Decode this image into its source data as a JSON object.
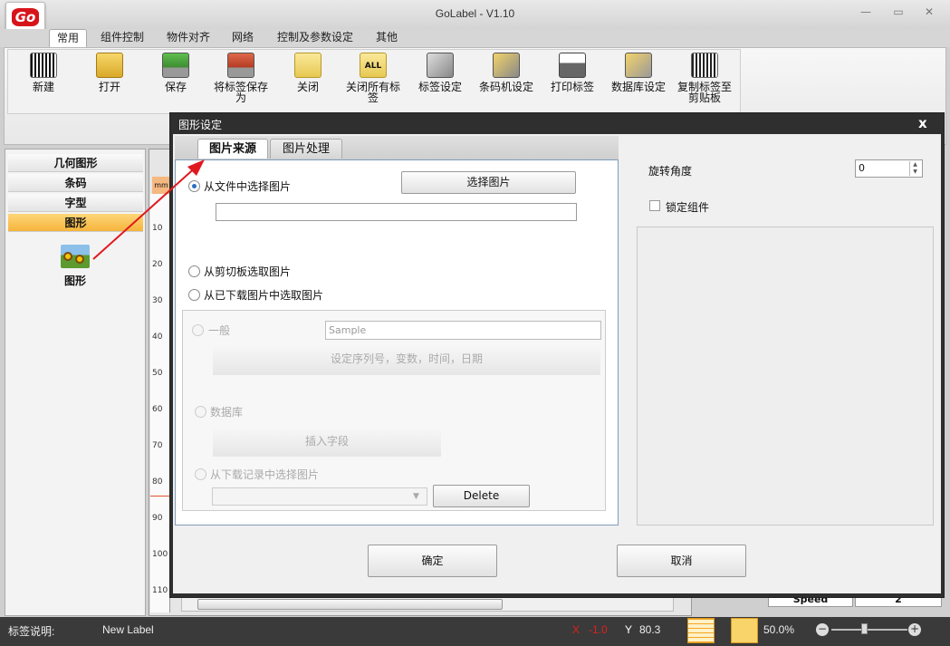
{
  "app": {
    "title": "GoLabel - V1.10",
    "logo": "Go"
  },
  "ribbon_tabs": [
    "常用",
    "组件控制",
    "物件对齐",
    "网络",
    "控制及参数设定",
    "其他"
  ],
  "toolbar": [
    {
      "label": "新建",
      "icon": "barcode-new-icon"
    },
    {
      "label": "打开",
      "icon": "folder-open-icon"
    },
    {
      "label": "保存",
      "icon": "save-icon"
    },
    {
      "label": "将标签保存为",
      "icon": "save-as-icon"
    },
    {
      "label": "关闭",
      "icon": "close-folder-icon"
    },
    {
      "label": "关闭所有标签",
      "icon": "close-all-icon"
    },
    {
      "label": "标签设定",
      "icon": "label-settings-icon"
    },
    {
      "label": "条码机设定",
      "icon": "printer-settings-icon"
    },
    {
      "label": "打印标签",
      "icon": "print-icon"
    },
    {
      "label": "数据库设定",
      "icon": "database-settings-icon"
    },
    {
      "label": "复制标签至剪贴板",
      "icon": "copy-clipboard-icon"
    }
  ],
  "left_panel": {
    "items": [
      "几何图形",
      "条码",
      "字型",
      "图形"
    ],
    "active": "图形",
    "shape_label": "图形"
  },
  "ruler": {
    "unit": "mm",
    "ticks": [
      "10",
      "20",
      "30",
      "40",
      "50",
      "60",
      "70",
      "80",
      "90",
      "100",
      "110"
    ]
  },
  "bottom_table": {
    "speed_label": "Speed",
    "speed_value": "2"
  },
  "status": {
    "label_desc": "标签说明:",
    "label_name": "New Label",
    "x_label": "X",
    "x_value": "-1.0",
    "y_label": "Y",
    "y_value": "80.3",
    "zoom": "50.0%"
  },
  "dialog": {
    "title": "图形设定",
    "close": "x",
    "tabs": [
      "图片来源",
      "图片处理"
    ],
    "source": {
      "from_file": "从文件中选择图片",
      "choose_button": "选择图片",
      "file_path": "",
      "from_clipboard": "从剪切板选取图片",
      "from_downloaded": "从已下载图片中选取图片",
      "general": "一般",
      "sample_value": "Sample",
      "serial_button": "设定序列号，变数，时间，日期",
      "database": "数据库",
      "insert_field": "插入字段",
      "from_record": "从下载记录中选择图片",
      "delete_button": "Delete"
    },
    "rotation_label": "旋转角度",
    "rotation_value": "0",
    "lock_label": "锁定组件",
    "ok_button": "确定",
    "cancel_button": "取消"
  }
}
